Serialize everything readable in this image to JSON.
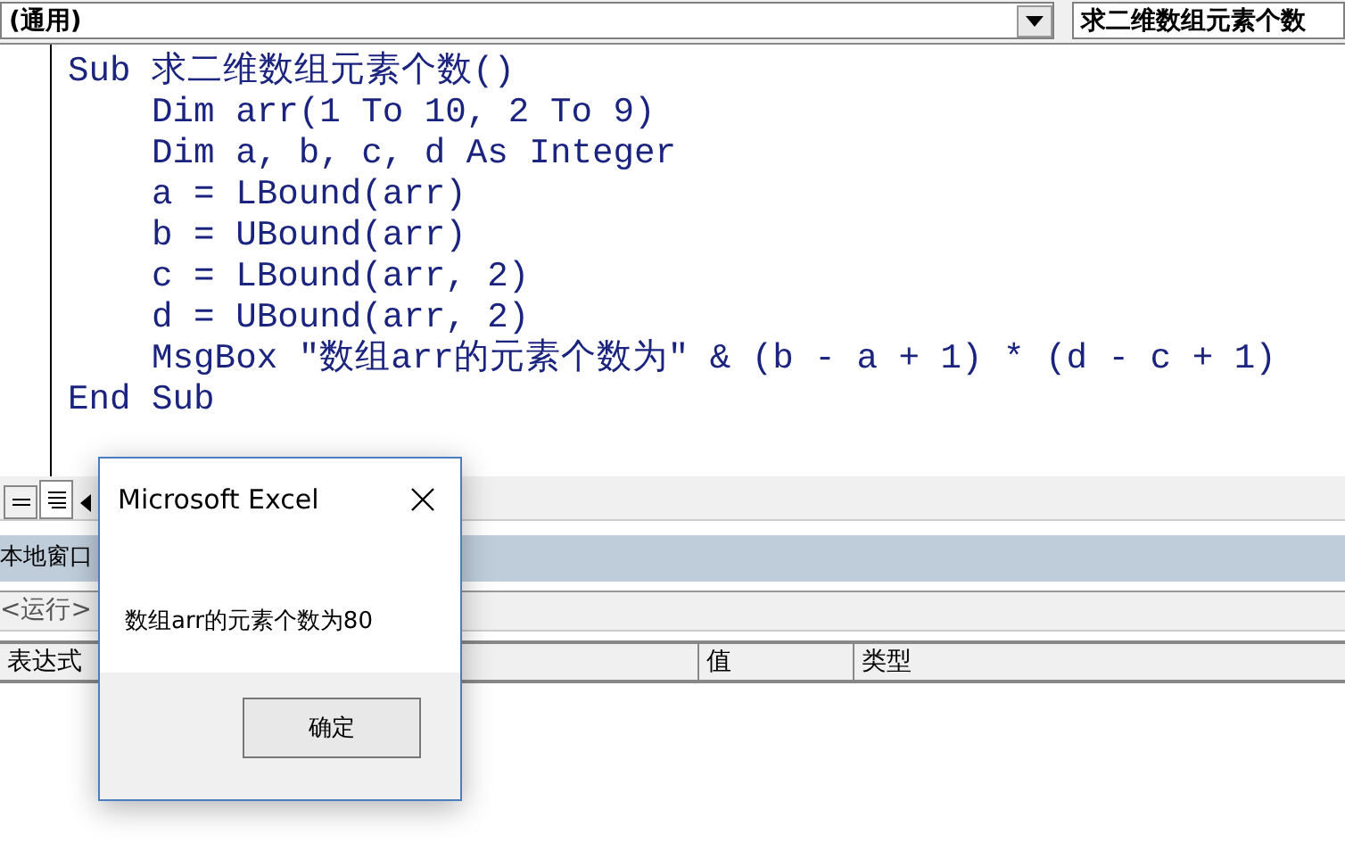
{
  "toolbar": {
    "object_combo": "(通用)",
    "procedure_combo": "求二维数组元素个数"
  },
  "code_lines": [
    "Sub 求二维数组元素个数()",
    "    Dim arr(1 To 10, 2 To 9)",
    "    Dim a, b, c, d As Integer",
    "    a = LBound(arr)",
    "    b = UBound(arr)",
    "    c = LBound(arr, 2)",
    "    d = UBound(arr, 2)",
    "    MsgBox \"数组arr的元素个数为\" & (b - a + 1) * (d - c + 1)",
    "End Sub"
  ],
  "view_buttons": [
    {
      "kind": "procedure",
      "selected": false
    },
    {
      "kind": "module",
      "selected": true
    }
  ],
  "locals_window": {
    "title": "本地窗口",
    "context": "<运行>",
    "columns": [
      "表达式",
      "值",
      "类型"
    ]
  },
  "dialog": {
    "title": "Microsoft Excel",
    "message": "数组arr的元素个数为80",
    "button": "确定"
  }
}
